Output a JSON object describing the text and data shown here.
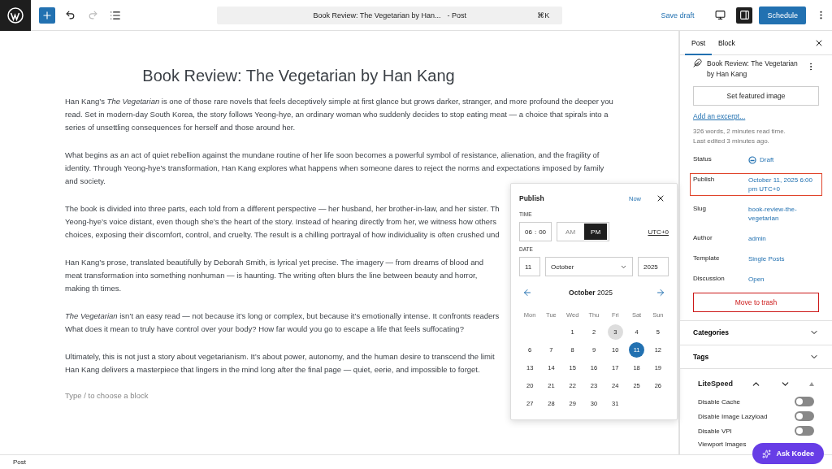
{
  "topbar": {
    "command_title": "Book Review: The Vegetarian by Han...",
    "command_suffix": "- Post",
    "shortcut": "⌘K",
    "save_draft": "Save draft",
    "schedule": "Schedule",
    "redo_disabled": true,
    "sidebar_open": true
  },
  "editor": {
    "title": "Book Review: The Vegetarian by Han Kang",
    "paragraphs": [
      {
        "text": "Han Kang’s *The Vegetarian* is one of those rare novels that feels deceptively simple at first glance but grows darker, stranger, and more profound the deeper you read. Set in modern-day South Korea, the story follows Yeong-hye, an ordinary woman who suddenly decides to stop eating meat — a choice that spirals into a series of unsettling consequences for herself and those around her."
      },
      {
        "text": "What begins as an act of quiet rebellion against the mundane routine of her life soon becomes a powerful symbol of resistance, alienation, and the fragility of identity. Through Yeong-hye’s transformation, Han Kang explores what happens when someone dares to reject the norms and expectations imposed by family and society."
      },
      {
        "text": "The book is divided into three parts, each told from a different perspective — her husband, her brother-in-law, and her sister. Th Yeong-hye’s voice distant, even though she’s the heart of the story. Instead of hearing directly from her, we witness how others choices, exposing their discomfort, control, and cruelty. The result is a chilling portrayal of how individuality is often crushed und"
      },
      {
        "text": "Han Kang’s prose, translated beautifully by Deborah Smith, is lyrical yet precise. The imagery — from dreams of blood and meat transformation into something nonhuman — is haunting. The writing often blurs the line between beauty and horror, making th times."
      },
      {
        "text": "*The Vegetarian* isn’t an easy read — not because it’s long or complex, but because it’s emotionally intense. It confronts readers What does it mean to truly have control over your body? How far would you go to escape a life that feels suffocating?"
      },
      {
        "text": "Ultimately, this is not just a story about vegetarianism. It’s about power, autonomy, and the human desire to transcend the limit Han Kang delivers a masterpiece that lingers in the mind long after the final page — quiet, eerie, and impossible to forget."
      }
    ],
    "placeholder": "Type / to choose a block"
  },
  "publish_popover": {
    "title": "Publish",
    "now": "Now",
    "time_label": "TIME",
    "hour": "06",
    "separator": ":",
    "minute": "00",
    "ampm": [
      {
        "label": "AM",
        "selected": false
      },
      {
        "label": "PM",
        "selected": true
      }
    ],
    "timezone": "UTC+0",
    "date_label": "DATE",
    "day": "11",
    "month": "October",
    "year": "2025",
    "calendar_month": "October",
    "calendar_year": "2025",
    "weekdays": [
      "Mon",
      "Tue",
      "Wed",
      "Thu",
      "Fri",
      "Sat",
      "Sun"
    ],
    "weeks": [
      [
        {
          "label": "1",
          "selected": false,
          "today": false
        },
        {
          "label": "2",
          "selected": false,
          "today": false
        },
        {
          "label": "3",
          "selected": false,
          "today": true
        },
        {
          "label": "4",
          "selected": false,
          "today": false
        },
        {
          "label": "5",
          "selected": false,
          "today": false
        }
      ],
      [
        {
          "label": "6",
          "selected": false,
          "today": false
        },
        {
          "label": "7",
          "selected": false,
          "today": false
        },
        {
          "label": "8",
          "selected": false,
          "today": false
        },
        {
          "label": "9",
          "selected": false,
          "today": false
        },
        {
          "label": "10",
          "selected": false,
          "today": false
        },
        {
          "label": "11",
          "selected": true,
          "today": false
        },
        {
          "label": "12",
          "selected": false,
          "today": false
        }
      ],
      [
        {
          "label": "13",
          "selected": false,
          "today": false
        },
        {
          "label": "14",
          "selected": false,
          "today": false
        },
        {
          "label": "15",
          "selected": false,
          "today": false
        },
        {
          "label": "16",
          "selected": false,
          "today": false
        },
        {
          "label": "17",
          "selected": false,
          "today": false
        },
        {
          "label": "18",
          "selected": false,
          "today": false
        },
        {
          "label": "19",
          "selected": false,
          "today": false
        }
      ],
      [
        {
          "label": "20",
          "selected": false,
          "today": false
        },
        {
          "label": "21",
          "selected": false,
          "today": false
        },
        {
          "label": "22",
          "selected": false,
          "today": false
        },
        {
          "label": "23",
          "selected": false,
          "today": false
        },
        {
          "label": "24",
          "selected": false,
          "today": false
        },
        {
          "label": "25",
          "selected": false,
          "today": false
        },
        {
          "label": "26",
          "selected": false,
          "today": false
        }
      ],
      [
        {
          "label": "27",
          "selected": false,
          "today": false
        },
        {
          "label": "28",
          "selected": false,
          "today": false
        },
        {
          "label": "29",
          "selected": false,
          "today": false
        },
        {
          "label": "30",
          "selected": false,
          "today": false
        },
        {
          "label": "31",
          "selected": false,
          "today": false
        }
      ]
    ]
  },
  "sidebar": {
    "tabs": [
      {
        "label": "Post",
        "selected": true
      },
      {
        "label": "Block",
        "selected": false
      }
    ],
    "post_title": "Book Review: The Vegetarian by Han Kang",
    "featured_image": "Set featured image",
    "excerpt_link": "Add an excerpt...",
    "stats": "326 words, 2 minutes read time.",
    "last_edited": "Last edited 3 minutes ago.",
    "fields": [
      {
        "label": "Status",
        "value": "Draft",
        "kind": "status",
        "highlighted": false
      },
      {
        "label": "Publish",
        "value": "October 11, 2025 6:00 pm UTC+0",
        "kind": "link",
        "highlighted": true
      },
      {
        "label": "Slug",
        "value": "book-review-the-vegetarian",
        "kind": "link",
        "highlighted": false
      },
      {
        "label": "Author",
        "value": "admin",
        "kind": "link",
        "highlighted": false
      },
      {
        "label": "Template",
        "value": "Single Posts",
        "kind": "link",
        "highlighted": false
      },
      {
        "label": "Discussion",
        "value": "Open",
        "kind": "link",
        "highlighted": false
      }
    ],
    "trash": "Move to trash",
    "panels": [
      {
        "label": "Categories",
        "expanded": false
      },
      {
        "label": "Tags",
        "expanded": false
      }
    ],
    "litespeed": {
      "title": "LiteSpeed",
      "options": [
        {
          "label": "Disable Cache",
          "on": false
        },
        {
          "label": "Disable Image Lazyload",
          "on": false
        },
        {
          "label": "Disable VPI",
          "on": false
        }
      ],
      "viewport_label": "Viewport Images"
    }
  },
  "assistant_button": "Ask Kodee",
  "status_bar": "Post"
}
